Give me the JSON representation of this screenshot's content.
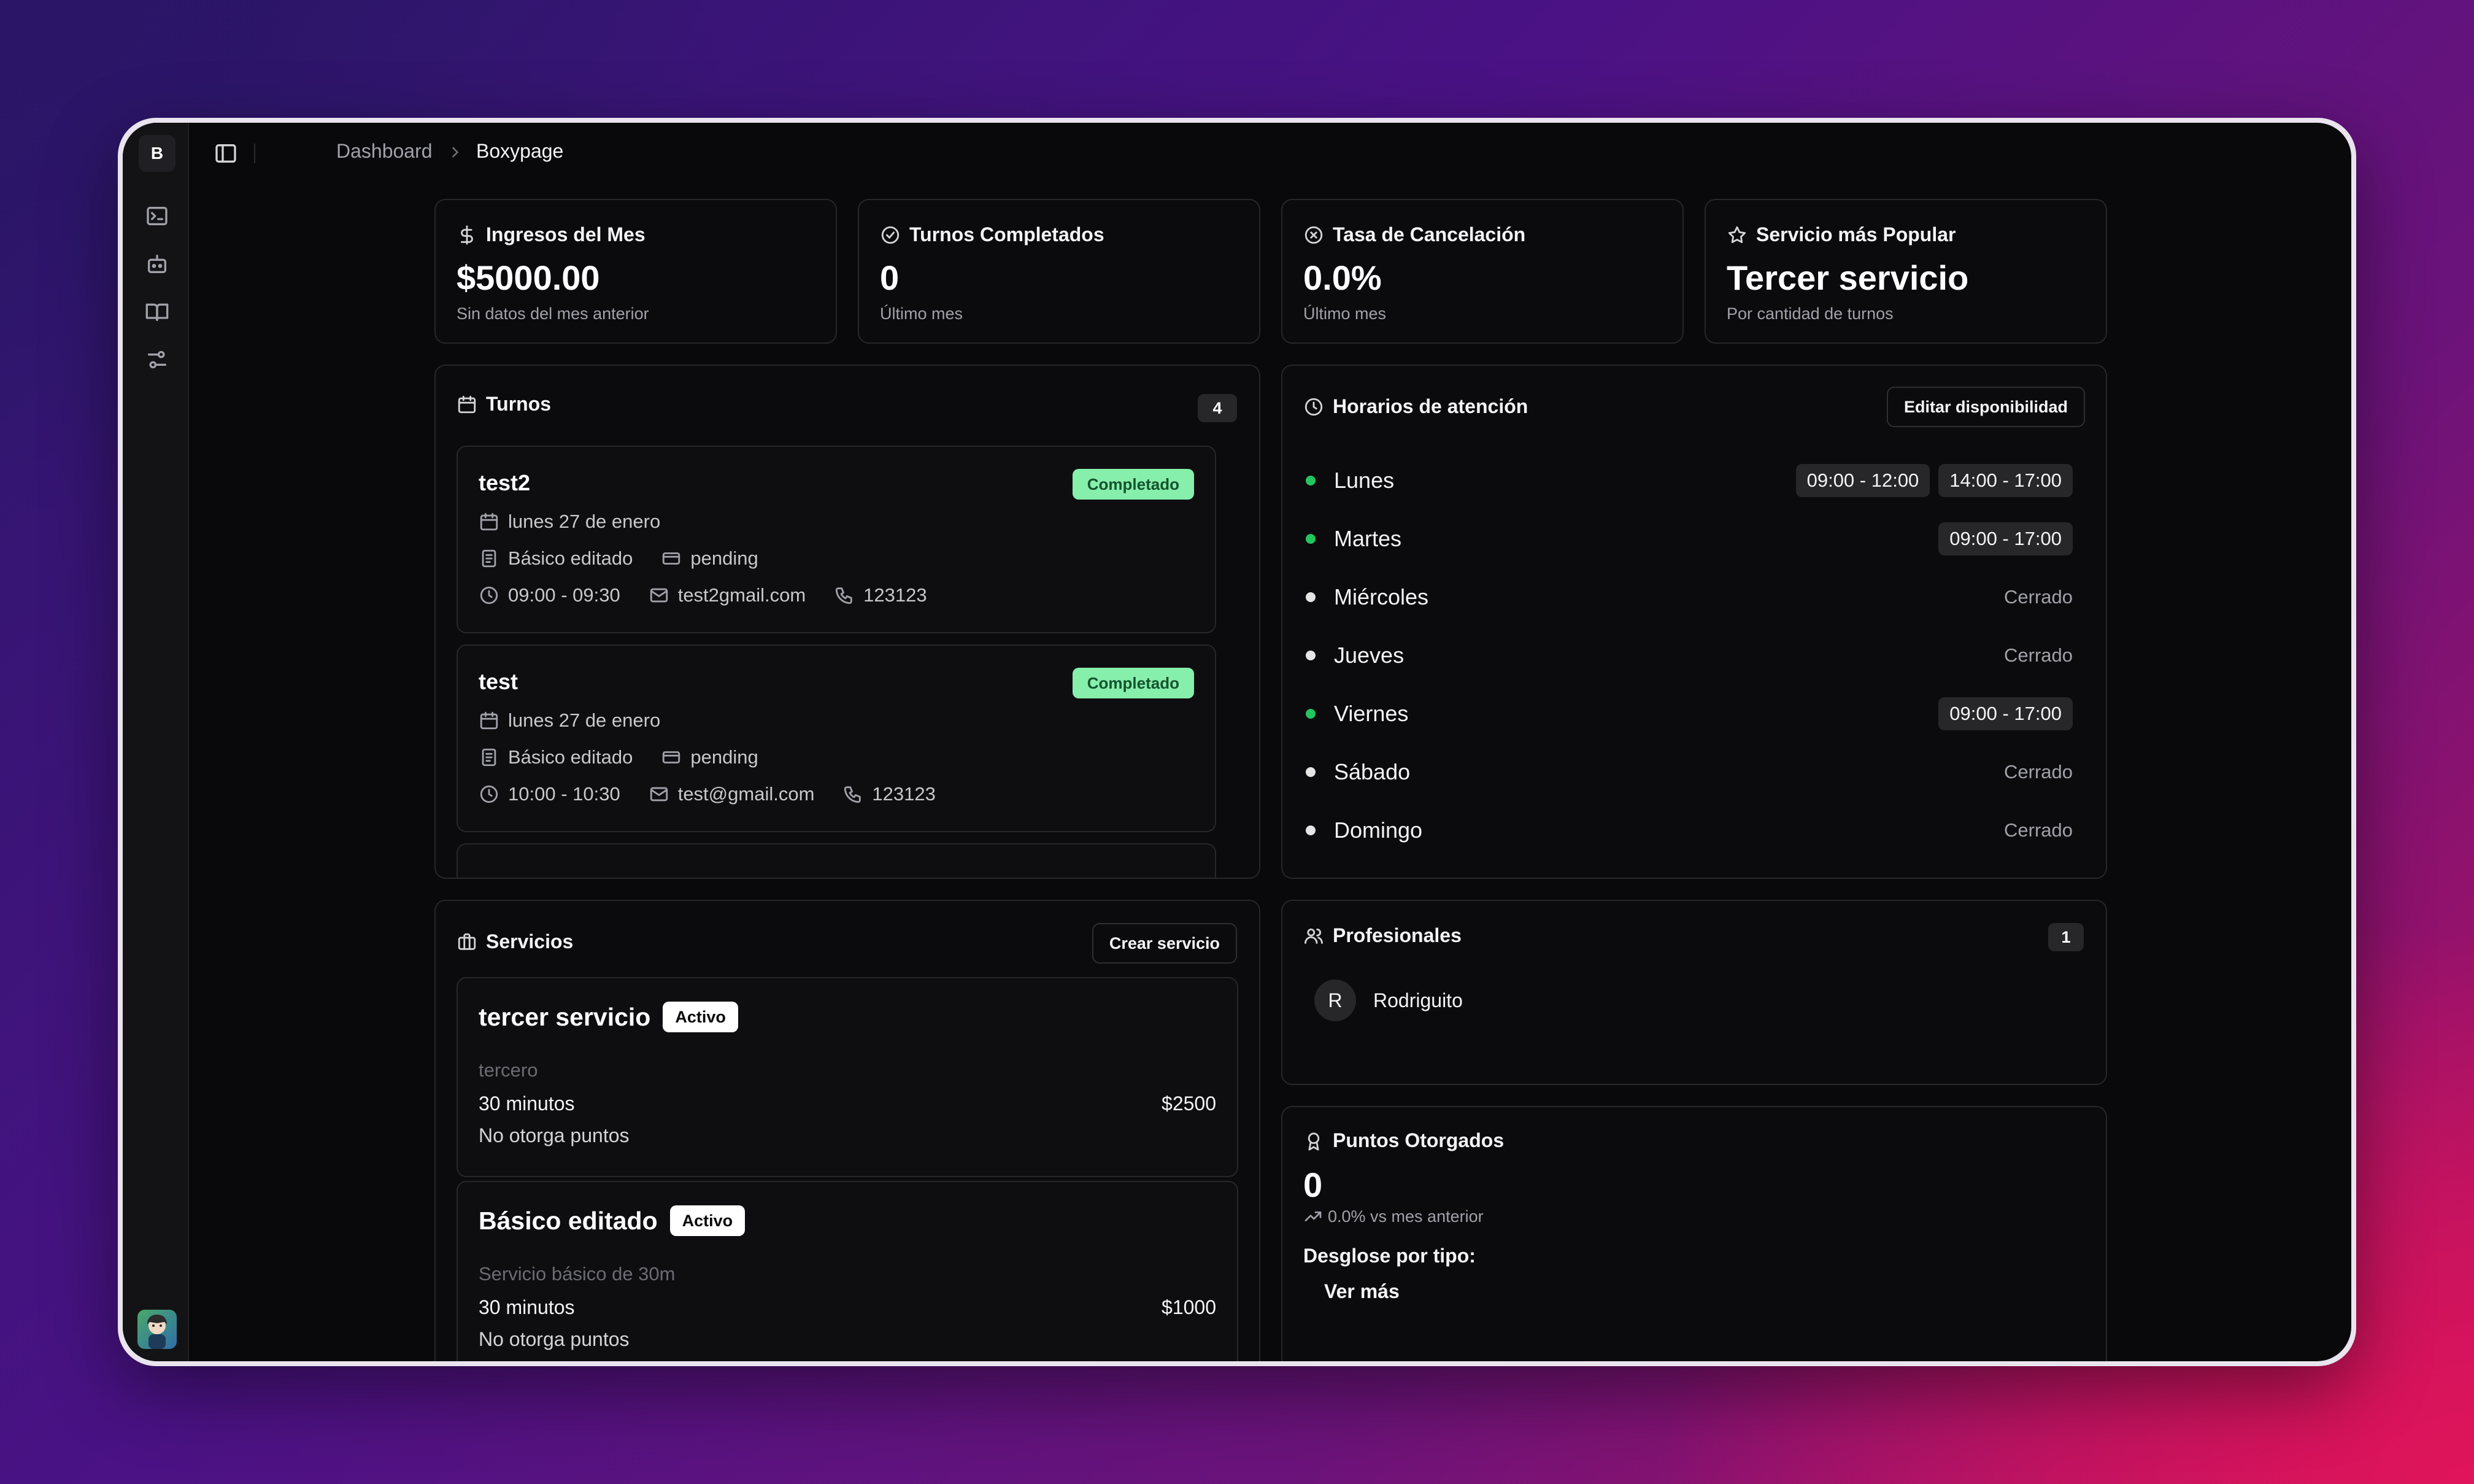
{
  "sidebar": {
    "logo_letter": "B",
    "icons": [
      "terminal-icon",
      "bot-icon",
      "book-icon",
      "settings-sliders-icon"
    ]
  },
  "breadcrumb": {
    "parent": "Dashboard",
    "current": "Boxypage"
  },
  "stats": [
    {
      "icon": "dollar-icon",
      "title": "Ingresos del Mes",
      "value": "$5000.00",
      "sub": "Sin datos del mes anterior"
    },
    {
      "icon": "check-circle-icon",
      "title": "Turnos Completados",
      "value": "0",
      "sub": "Último mes"
    },
    {
      "icon": "x-circle-icon",
      "title": "Tasa de Cancelación",
      "value": "0.0%",
      "sub": "Último mes"
    },
    {
      "icon": "star-icon",
      "title": "Servicio más Popular",
      "value": "Tercer servicio",
      "sub": "Por cantidad de turnos"
    }
  ],
  "turnos": {
    "title": "Turnos",
    "count": "4",
    "items": [
      {
        "name": "test2",
        "status": "Completado",
        "date": "lunes 27 de enero",
        "service": "Básico editado",
        "payment": "pending",
        "time": "09:00 - 09:30",
        "email": "test2gmail.com",
        "phone": "123123"
      },
      {
        "name": "test",
        "status": "Completado",
        "date": "lunes 27 de enero",
        "service": "Básico editado",
        "payment": "pending",
        "time": "10:00 - 10:30",
        "email": "test@gmail.com",
        "phone": "123123"
      }
    ]
  },
  "horarios": {
    "title": "Horarios de atención",
    "edit_label": "Editar disponibilidad",
    "closed_label": "Cerrado",
    "days": [
      {
        "name": "Lunes",
        "open": true,
        "slots": [
          "09:00 - 12:00",
          "14:00 - 17:00"
        ]
      },
      {
        "name": "Martes",
        "open": true,
        "slots": [
          "09:00 - 17:00"
        ]
      },
      {
        "name": "Miércoles",
        "open": false,
        "slots": []
      },
      {
        "name": "Jueves",
        "open": false,
        "slots": []
      },
      {
        "name": "Viernes",
        "open": true,
        "slots": [
          "09:00 - 17:00"
        ]
      },
      {
        "name": "Sábado",
        "open": false,
        "slots": []
      },
      {
        "name": "Domingo",
        "open": false,
        "slots": []
      }
    ]
  },
  "servicios": {
    "title": "Servicios",
    "create_label": "Crear servicio",
    "items": [
      {
        "name": "tercer servicio",
        "badge": "Activo",
        "desc": "tercero",
        "duration": "30 minutos",
        "price": "$2500",
        "points": "No otorga puntos"
      },
      {
        "name": "Básico editado",
        "badge": "Activo",
        "desc": "Servicio básico de 30m",
        "duration": "30 minutos",
        "price": "$1000",
        "points": "No otorga puntos"
      }
    ]
  },
  "profesionales": {
    "title": "Profesionales",
    "count": "1",
    "items": [
      {
        "initial": "R",
        "name": "Rodriguito"
      }
    ]
  },
  "puntos": {
    "title": "Puntos Otorgados",
    "value": "0",
    "trend": "0.0% vs mes anterior",
    "breakdown_label": "Desglose por tipo:",
    "more_label": "Ver más"
  },
  "colors": {
    "accent_green": "#22c55e",
    "badge_green": "#86efac",
    "background": "#09090b",
    "border": "#27272a"
  }
}
